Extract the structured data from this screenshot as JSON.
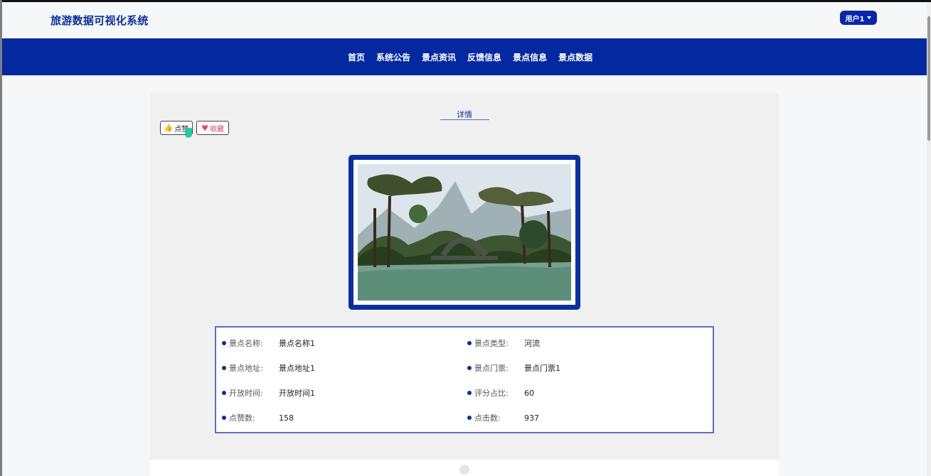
{
  "app": {
    "title": "旅游数据可视化系统",
    "user_menu": "用户1"
  },
  "nav": {
    "items": [
      "首页",
      "系统公告",
      "景点资讯",
      "反馈信息",
      "景点信息",
      "景点数据"
    ]
  },
  "detail": {
    "heading": "详情",
    "like_label": "点赞",
    "favorite_label": "收藏",
    "image_description": "景点图片"
  },
  "info": {
    "rows": [
      [
        {
          "label": "景点名称:",
          "value": "景点名称1"
        },
        {
          "label": "景点类型:",
          "value": "河流"
        }
      ],
      [
        {
          "label": "景点地址:",
          "value": "景点地址1"
        },
        {
          "label": "景点门票:",
          "value": "景点门票1"
        }
      ],
      [
        {
          "label": "开放时间:",
          "value": "开放时间1"
        },
        {
          "label": "评分占比:",
          "value": "60"
        }
      ],
      [
        {
          "label": "点赞数:",
          "value": "158"
        },
        {
          "label": "点击数:",
          "value": "937"
        }
      ]
    ]
  },
  "colors": {
    "primary": "#0328a0",
    "title": "#0a2e99",
    "favorite": "#e0496a"
  }
}
